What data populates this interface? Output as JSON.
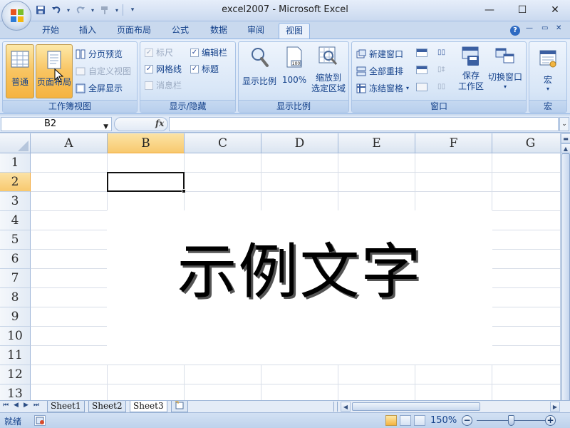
{
  "window": {
    "title": "excel2007 - Microsoft Excel",
    "minimize": "—",
    "maximize": "☐",
    "close": "✕"
  },
  "qat": {
    "save": "💾",
    "undo": "↶",
    "redo": "↷",
    "customize": "▾"
  },
  "tabs": [
    "开始",
    "插入",
    "页面布局",
    "公式",
    "数据",
    "审阅",
    "视图"
  ],
  "active_tab": "视图",
  "ribbon_ctrl": {
    "help": "?",
    "minimize": "—",
    "restore": "▭",
    "close": "✕"
  },
  "groups": {
    "workbook_views": {
      "label": "工作簿视图",
      "normal": "普通",
      "page_layout": "页面布局",
      "page_break_preview": "分页预览",
      "custom_views": "自定义视图",
      "full_screen": "全屏显示"
    },
    "show_hide": {
      "label": "显示/隐藏",
      "ruler": "标尺",
      "gridlines": "网格线",
      "message_bar": "消息栏",
      "formula_bar": "编辑栏",
      "headings": "标题",
      "ruler_checked": true,
      "gridlines_checked": true,
      "message_bar_checked": false,
      "formula_bar_checked": true,
      "headings_checked": true
    },
    "zoom": {
      "label": "显示比例",
      "zoom": "显示比例",
      "zoom_100": "100%",
      "zoom_to_selection_1": "缩放到",
      "zoom_to_selection_2": "选定区域"
    },
    "window": {
      "label": "窗口",
      "new_window": "新建窗口",
      "arrange_all": "全部重排",
      "freeze_panes": "冻结窗格",
      "save_workspace_1": "保存",
      "save_workspace_2": "工作区",
      "switch_windows": "切换窗口"
    },
    "macros": {
      "label": "宏",
      "macros": "宏"
    }
  },
  "formula_bar": {
    "name_box": "B2",
    "fx": "fx",
    "value": ""
  },
  "grid": {
    "columns": [
      "A",
      "B",
      "C",
      "D",
      "E",
      "F",
      "G"
    ],
    "rows": [
      "1",
      "2",
      "3",
      "4",
      "5",
      "6",
      "7",
      "8",
      "9",
      "10",
      "11",
      "12",
      "13"
    ],
    "selected_col": "B",
    "selected_row": "2",
    "sample_text": "示例文字"
  },
  "sheets": [
    "Sheet1",
    "Sheet2",
    "Sheet3"
  ],
  "active_sheet": "Sheet3",
  "status": {
    "ready": "就绪",
    "zoom": "150%",
    "zoom_out": "−",
    "zoom_in": "+"
  }
}
